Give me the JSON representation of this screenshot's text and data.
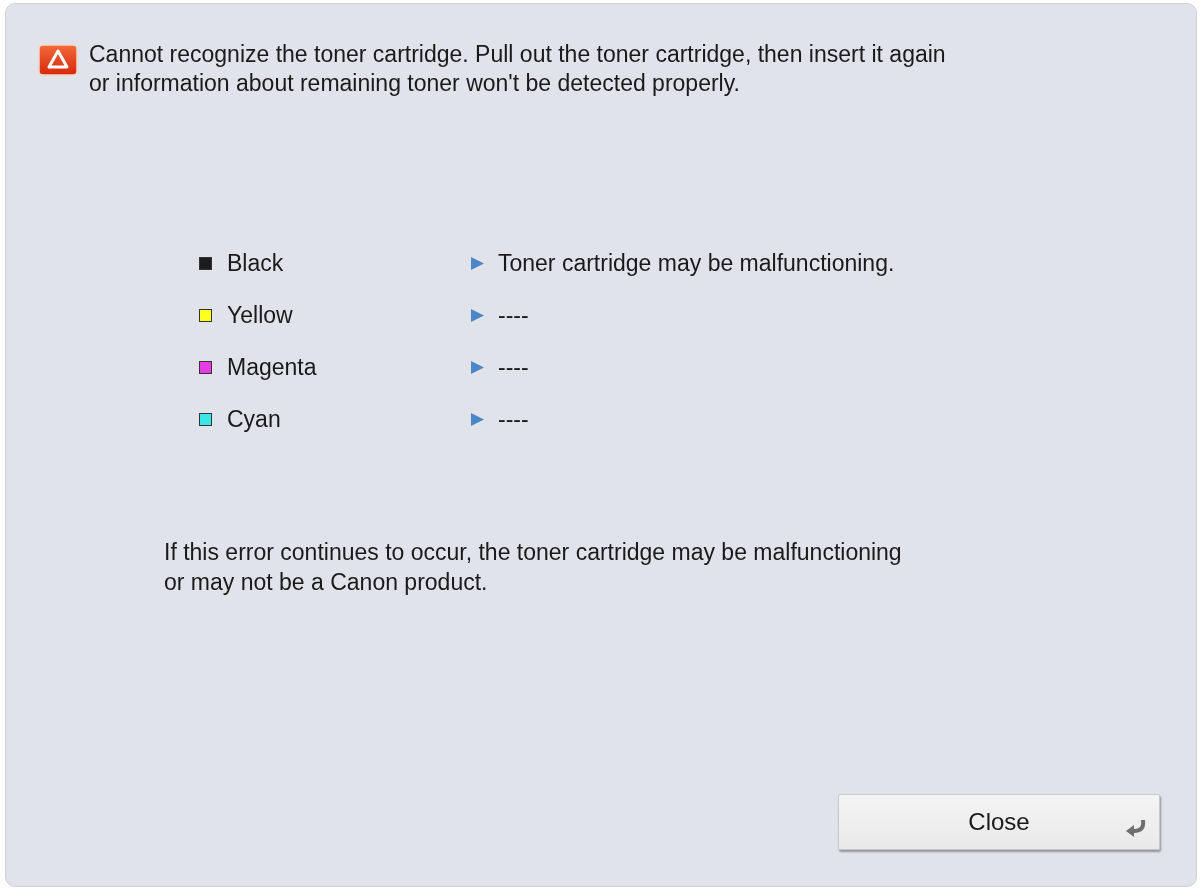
{
  "alert": {
    "message": "Cannot recognize the toner cartridge. Pull out the toner cartridge, then insert it again or information about remaining toner won't be detected properly."
  },
  "toners": [
    {
      "name": "Black",
      "color": "#1c1c1c",
      "status": "Toner cartridge may be malfunctioning."
    },
    {
      "name": "Yellow",
      "color": "#ffff1e",
      "status": "----"
    },
    {
      "name": "Magenta",
      "color": "#e63ce6",
      "status": "----"
    },
    {
      "name": "Cyan",
      "color": "#3ce6e6",
      "status": "----"
    }
  ],
  "note": "If this error continues to occur, the toner cartridge may be malfunctioning or may not be a Canon product.",
  "close_button": {
    "label": "Close"
  }
}
